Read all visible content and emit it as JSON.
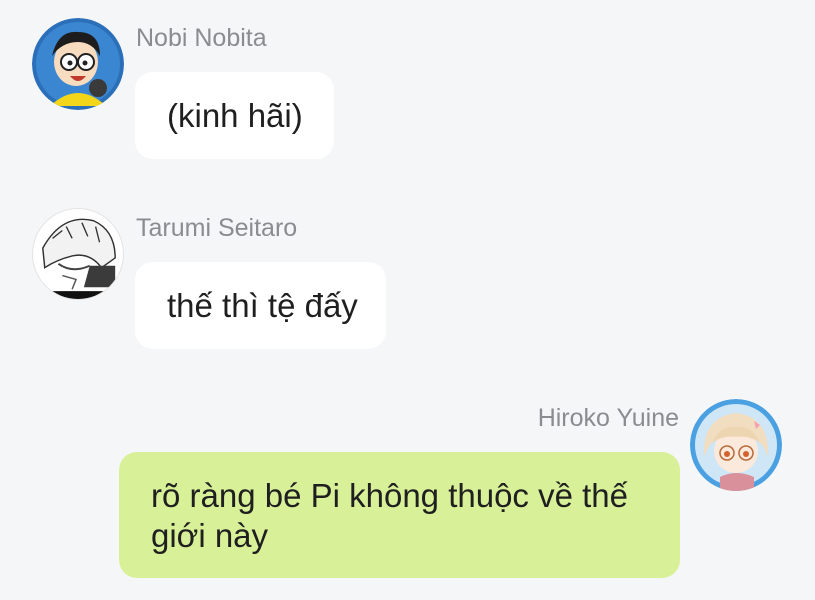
{
  "messages": [
    {
      "sender": "Nobi Nobita",
      "text": "(kinh hãi)",
      "avatar_icon": "doraemon-nobita-avatar-icon",
      "side": "left"
    },
    {
      "sender": "Tarumi Seitaro",
      "text": "thế thì tệ đấy",
      "avatar_icon": "manga-character-avatar-icon",
      "side": "left"
    },
    {
      "sender": "Hiroko Yuine",
      "text": "rõ ràng bé Pi không thuộc về thế giới này",
      "avatar_icon": "anime-girl-avatar-icon",
      "side": "right"
    }
  ],
  "colors": {
    "background": "#f5f6f8",
    "incoming_bubble": "#ffffff",
    "outgoing_bubble": "#d8f199",
    "sender_name": "#8a8c90",
    "message_text": "#1f1f1f"
  }
}
